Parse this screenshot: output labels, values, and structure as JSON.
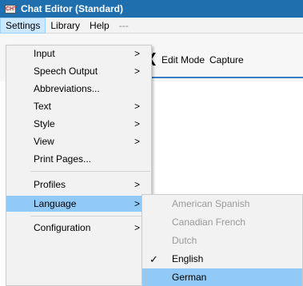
{
  "window": {
    "title": "Chat Editor (Standard)",
    "icon_text": "CHT"
  },
  "menubar": {
    "settings": "Settings",
    "library": "Library",
    "help": "Help",
    "more": "---"
  },
  "toolbar": {
    "chevron": "❮",
    "edit_mode": "Edit Mode",
    "capture": "Capture"
  },
  "settings_menu": {
    "items": [
      {
        "label": "Input",
        "arrow": ">"
      },
      {
        "label": "Speech Output",
        "arrow": ">"
      },
      {
        "label": "Abbreviations...",
        "arrow": ""
      },
      {
        "label": "Text",
        "arrow": ">"
      },
      {
        "label": "Style",
        "arrow": ">"
      },
      {
        "label": "View",
        "arrow": ">"
      },
      {
        "label": "Print Pages...",
        "arrow": ""
      },
      {
        "label": "Profiles",
        "arrow": ">"
      },
      {
        "label": "Language",
        "arrow": ">"
      },
      {
        "label": "Configuration",
        "arrow": ">"
      }
    ],
    "highlighted": "Language"
  },
  "language_submenu": {
    "items": [
      {
        "label": "American Spanish",
        "state": "disabled"
      },
      {
        "label": "Canadian French",
        "state": "disabled"
      },
      {
        "label": "Dutch",
        "state": "disabled"
      },
      {
        "label": "English",
        "state": "checked"
      },
      {
        "label": "German",
        "state": "highlighted"
      }
    ],
    "check_glyph": "✓"
  },
  "colors": {
    "titlebar": "#1f6fae",
    "highlight": "#91c9f7",
    "menu_bg": "#f2f2f2"
  }
}
